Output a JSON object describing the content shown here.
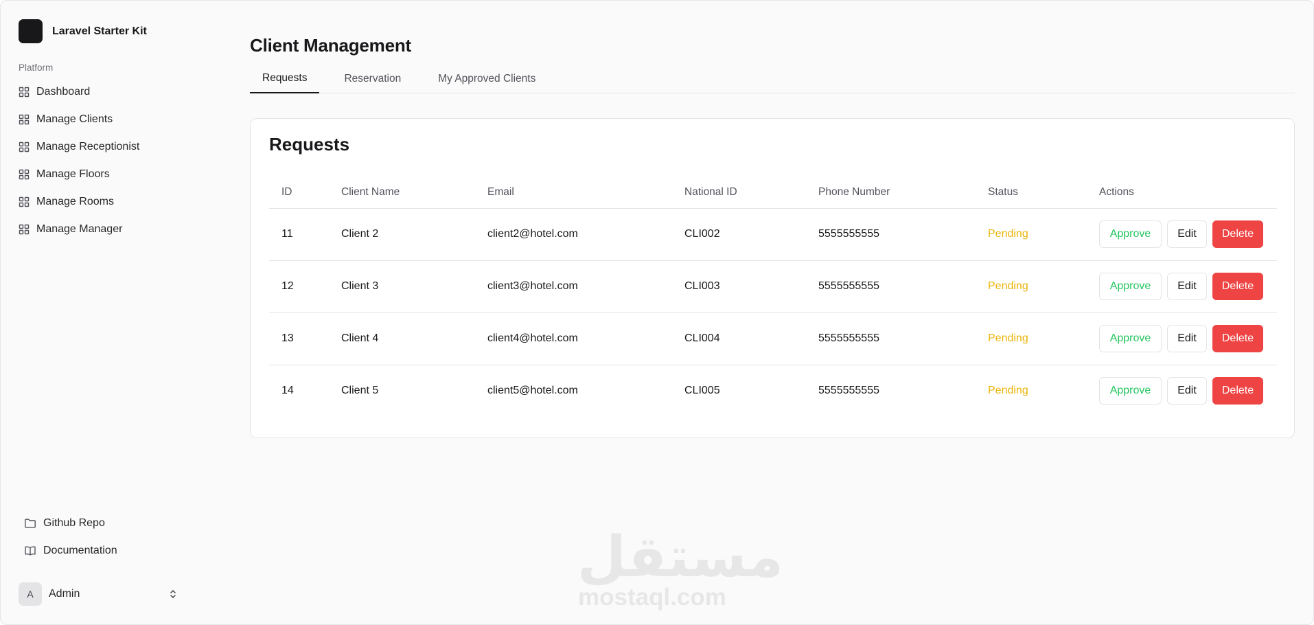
{
  "app": {
    "name": "Laravel Starter Kit"
  },
  "sidebar": {
    "group_label": "Platform",
    "items": [
      {
        "label": "Dashboard",
        "icon": "grid-icon"
      },
      {
        "label": "Manage Clients",
        "icon": "grid-icon"
      },
      {
        "label": "Manage Receptionist",
        "icon": "grid-icon"
      },
      {
        "label": "Manage Floors",
        "icon": "grid-icon"
      },
      {
        "label": "Manage Rooms",
        "icon": "grid-icon"
      },
      {
        "label": "Manage Manager",
        "icon": "grid-icon"
      }
    ],
    "bottom_links": [
      {
        "label": "Github Repo",
        "icon": "folder-icon"
      },
      {
        "label": "Documentation",
        "icon": "book-icon"
      }
    ],
    "user": {
      "initial": "A",
      "name": "Admin",
      "icon": "chevrons-up-down-icon"
    }
  },
  "main": {
    "title": "Client Management",
    "tabs": [
      {
        "label": "Requests",
        "active": true
      },
      {
        "label": "Reservation",
        "active": false
      },
      {
        "label": "My Approved Clients",
        "active": false
      }
    ],
    "card": {
      "title": "Requests",
      "columns": [
        "ID",
        "Client Name",
        "Email",
        "National ID",
        "Phone Number",
        "Status",
        "Actions"
      ],
      "rows": [
        {
          "id": "11",
          "name": "Client 2",
          "email": "client2@hotel.com",
          "national_id": "CLI002",
          "phone": "5555555555",
          "status": "Pending"
        },
        {
          "id": "12",
          "name": "Client 3",
          "email": "client3@hotel.com",
          "national_id": "CLI003",
          "phone": "5555555555",
          "status": "Pending"
        },
        {
          "id": "13",
          "name": "Client 4",
          "email": "client4@hotel.com",
          "national_id": "CLI004",
          "phone": "5555555555",
          "status": "Pending"
        },
        {
          "id": "14",
          "name": "Client 5",
          "email": "client5@hotel.com",
          "national_id": "CLI005",
          "phone": "5555555555",
          "status": "Pending"
        }
      ],
      "actions": {
        "approve": "Approve",
        "edit": "Edit",
        "delete": "Delete"
      }
    }
  },
  "watermark": {
    "arabic": "مستقل",
    "latin": "mostaql.com"
  },
  "colors": {
    "status_pending": "#eab308",
    "approve": "#22c55e",
    "delete": "#ef4444",
    "text": "#18181b"
  }
}
